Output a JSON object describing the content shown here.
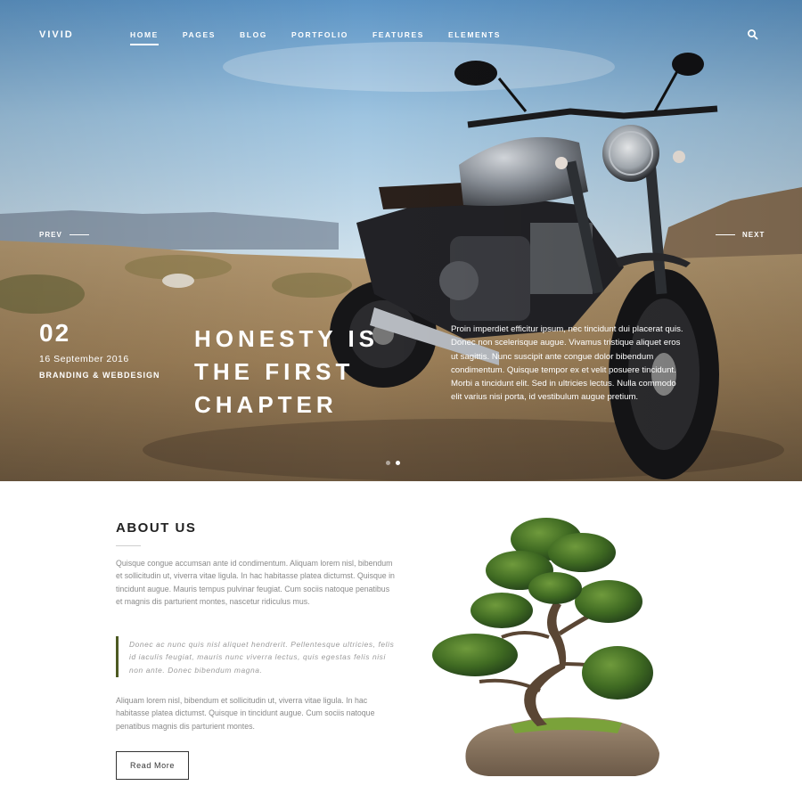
{
  "header": {
    "logo": "VIVID",
    "nav": [
      "HOME",
      "PAGES",
      "BLOG",
      "PORTFOLIO",
      "FEATURES",
      "ELEMENTS"
    ],
    "active_nav": "HOME",
    "search_icon": "search-icon"
  },
  "slider": {
    "prev_label": "PREV",
    "next_label": "NEXT",
    "number": "02",
    "date": "16 September 2016",
    "category": "BRANDING & WEBDESIGN",
    "headline_lines": [
      "HONESTY IS",
      "THE FIRST",
      "CHAPTER"
    ],
    "text": "Proin imperdiet efficitur ipsum, nec tincidunt dui placerat quis. Donec non scelerisque augue. Vivamus tristique aliquet eros ut sagittis. Nunc suscipit ante congue dolor bibendum condimentum. Quisque tempor ex et velit posuere tincidunt. Morbi a tincidunt elit. Sed in ultricies lectus. Nulla commodo elit varius nisi porta, id vestibulum augue pretium.",
    "dots": 2,
    "active_dot": 1
  },
  "about": {
    "title": "ABOUT US",
    "paragraph1": "Quisque congue accumsan ante id condimentum. Aliquam lorem nisl, bibendum et sollicitudin ut, viverra vitae ligula. In hac habitasse platea dictumst. Quisque in tincidunt augue. Mauris tempus pulvinar feugiat. Cum sociis natoque penatibus et magnis dis parturient montes, nascetur ridiculus mus.",
    "quote": "Donec ac nunc quis nisl aliquet hendrerit. Pellentesque ultricies, felis id iaculis feugiat, mauris nunc viverra lectus, quis egestas felis nisi non ante. Donec bibendum magna.",
    "paragraph2": "Aliquam lorem nisl, bibendum et sollicitudin ut, viverra vitae ligula. In hac habitasse platea dictumst. Quisque in tincidunt augue. Cum sociis natoque penatibus magnis dis parturient montes.",
    "button": "Read More"
  },
  "colors": {
    "quote_border": "#4d5a22",
    "text_muted": "#8a8a8a",
    "heading": "#222222"
  }
}
